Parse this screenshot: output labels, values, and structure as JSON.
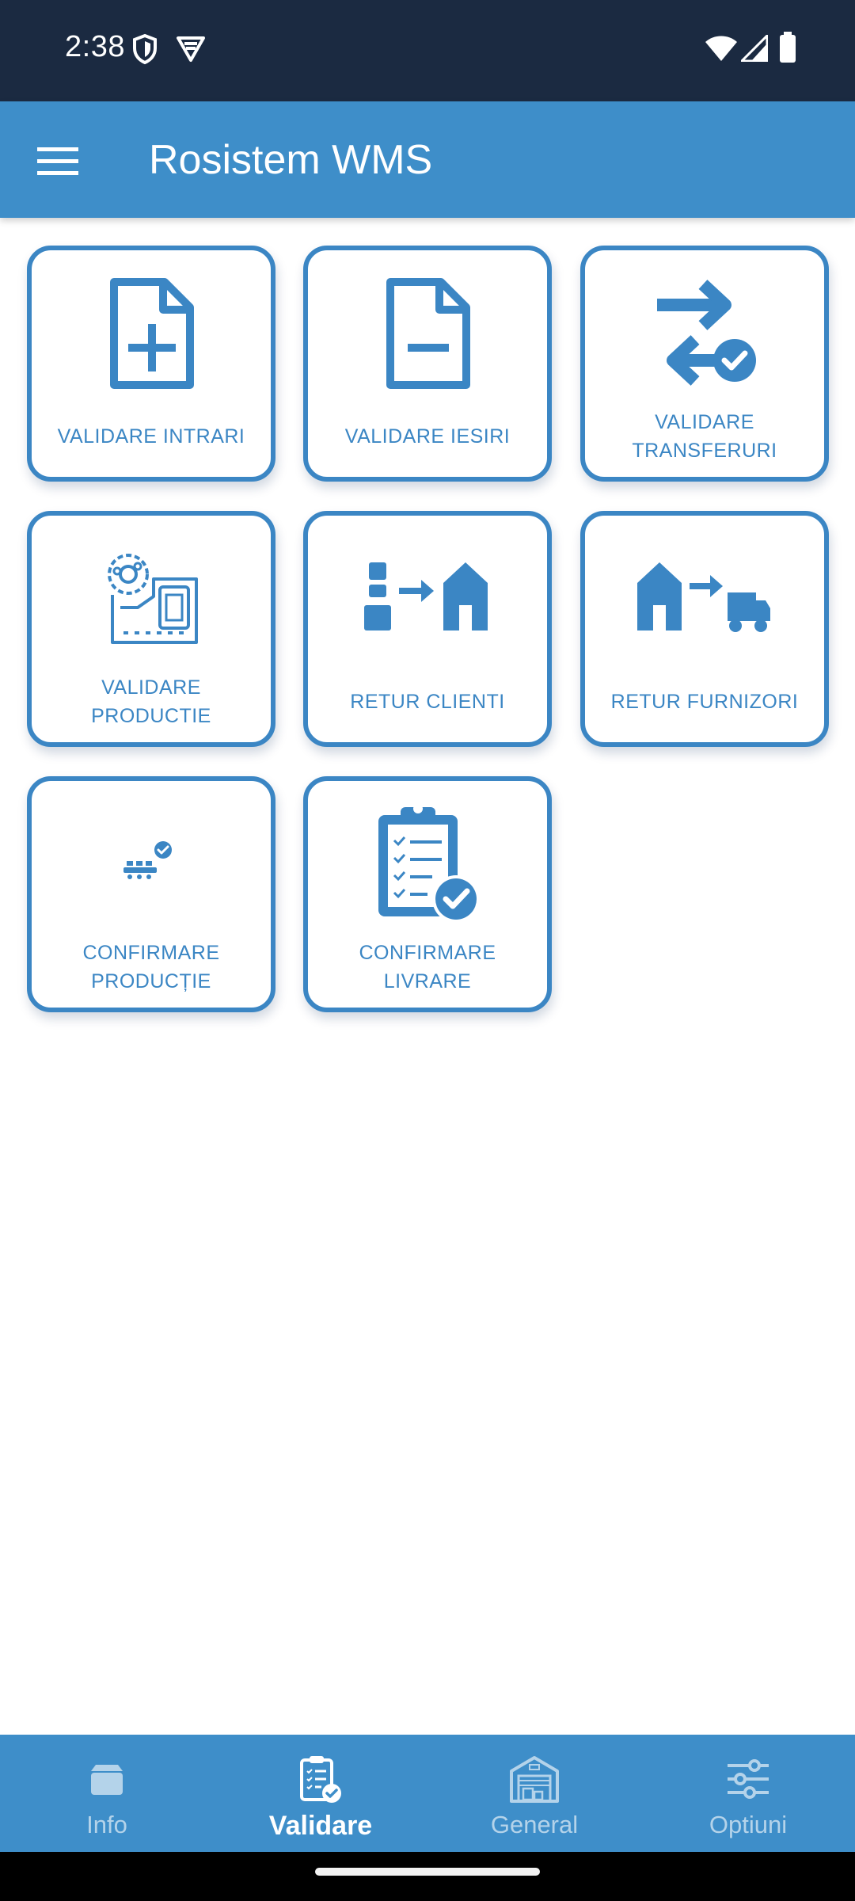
{
  "status_bar": {
    "time": "2:38"
  },
  "app_bar": {
    "title": "Rosistem WMS"
  },
  "tiles": [
    {
      "label": "VALIDARE INTRARI",
      "icon": "file-plus-icon"
    },
    {
      "label": "VALIDARE IESIRI",
      "icon": "file-minus-icon"
    },
    {
      "label": "VALIDARE\nTRANSFERURI",
      "icon": "transfer-arrows-check-icon"
    },
    {
      "label": "VALIDARE\nPRODUCTIE",
      "icon": "production-machine-icon"
    },
    {
      "label": "RETUR CLIENTI",
      "icon": "customer-to-warehouse-icon"
    },
    {
      "label": "RETUR FURNIZORI",
      "icon": "warehouse-to-truck-icon"
    },
    {
      "label": "CONFIRMARE\nPRODUCȚIE",
      "icon": "conveyor-check-icon"
    },
    {
      "label": "CONFIRMARE\nLIVRARE",
      "icon": "clipboard-check-icon"
    }
  ],
  "bottom_nav": {
    "items": [
      {
        "label": "Info",
        "icon": "box-icon"
      },
      {
        "label": "Validare",
        "icon": "clipboard-check-icon",
        "active": true
      },
      {
        "label": "General",
        "icon": "warehouse-icon"
      },
      {
        "label": "Optiuni",
        "icon": "sliders-icon"
      }
    ]
  },
  "colors": {
    "status_bar": "#1b2a41",
    "primary": "#3e8ec9",
    "tile_accent": "#3b86c4",
    "nav_inactive": "#b4d3ea"
  }
}
